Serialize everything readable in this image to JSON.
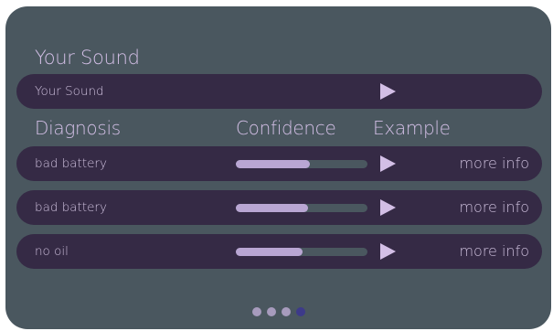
{
  "your_sound": {
    "heading": "Your Sound",
    "row_label": "Your Sound"
  },
  "columns": {
    "diagnosis": "Diagnosis",
    "confidence": "Confidence",
    "example": "Example"
  },
  "diagnoses": [
    {
      "label": "bad battery",
      "confidence": 0.56,
      "more_info": "more info"
    },
    {
      "label": "bad battery",
      "confidence": 0.55,
      "more_info": "more info"
    },
    {
      "label": "no oil",
      "confidence": 0.51,
      "more_info": "more info"
    }
  ],
  "pagination": {
    "count": 4,
    "active_index": 3
  },
  "colors": {
    "card": "#4a575f",
    "row": "#352a45",
    "accent": "#d3bfe6",
    "bar_fill": "#b9a6d3",
    "play": "#d3bfe6",
    "dot": "#a79bbd",
    "dot_active": "#3d3a8a"
  },
  "icons": {
    "play": "play-icon"
  }
}
